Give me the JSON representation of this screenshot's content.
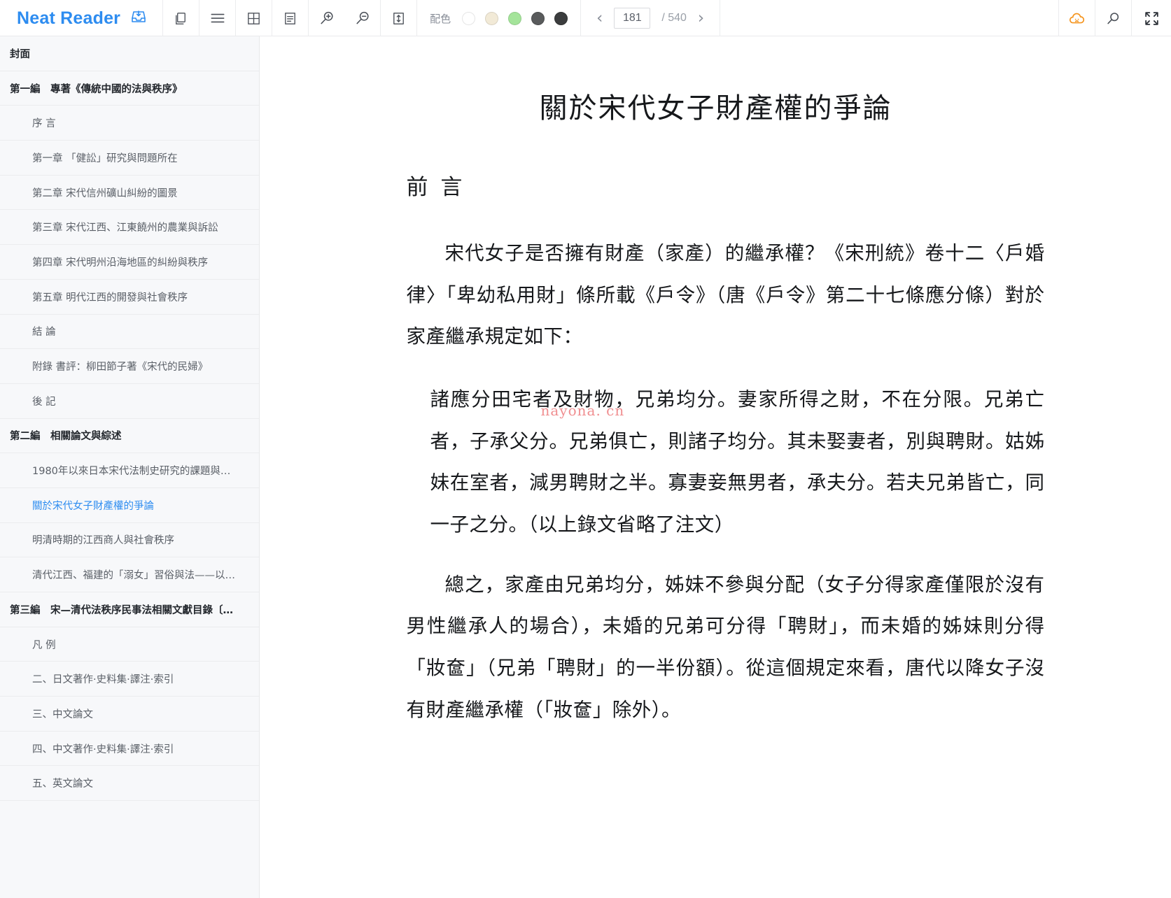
{
  "app": {
    "brand": "Neat Reader"
  },
  "toolbar": {
    "icons": [
      {
        "name": "import-book-icon",
        "label": "Import"
      },
      {
        "name": "bookshelf-icon",
        "label": "Bookshelf"
      },
      {
        "name": "contents-list-icon",
        "label": "Contents"
      },
      {
        "name": "grid-view-icon",
        "label": "Grid view"
      },
      {
        "name": "notes-icon",
        "label": "Notes"
      },
      {
        "name": "zoom-in-icon",
        "label": "Zoom in"
      },
      {
        "name": "zoom-out-icon",
        "label": "Zoom out"
      },
      {
        "name": "line-height-icon",
        "label": "Line height"
      }
    ],
    "palette": {
      "label": "配色",
      "swatches": [
        "#ffffff",
        "#f2ead7",
        "#a4e49a",
        "#595b5c",
        "#3b3d3e"
      ],
      "selected_index": 0
    },
    "pager": {
      "prev_label": "‹",
      "next_label": "›",
      "current_page": "181",
      "total_label": "/ 540"
    },
    "right_icons": [
      {
        "name": "cloud-sync-icon",
        "label": "Cloud sync",
        "color": "#f5941d"
      },
      {
        "name": "search-icon",
        "label": "Search"
      },
      {
        "name": "fullscreen-icon",
        "label": "Fullscreen"
      }
    ]
  },
  "sidebar": {
    "items": [
      {
        "label": "封面",
        "level": 0,
        "active": false
      },
      {
        "label": "第一編　專著《傳統中國的法與秩序》",
        "level": 0,
        "active": false
      },
      {
        "label": "序 言",
        "level": 1,
        "active": false
      },
      {
        "label": "第一章 「健訟」研究與問題所在",
        "level": 1,
        "active": false
      },
      {
        "label": "第二章 宋代信州礦山糾紛的圖景",
        "level": 1,
        "active": false
      },
      {
        "label": "第三章 宋代江西、江東饒州的農業與訴訟",
        "level": 1,
        "active": false
      },
      {
        "label": "第四章 宋代明州沿海地區的糾紛與秩序",
        "level": 1,
        "active": false
      },
      {
        "label": "第五章 明代江西的開發與社會秩序",
        "level": 1,
        "active": false
      },
      {
        "label": "結 論",
        "level": 1,
        "active": false
      },
      {
        "label": "附錄 書評：柳田節子著《宋代的民婦》",
        "level": 1,
        "active": false
      },
      {
        "label": "後 記",
        "level": 1,
        "active": false
      },
      {
        "label": "第二編　相關論文與綜述",
        "level": 0,
        "active": false
      },
      {
        "label": "1980年以來日本宋代法制史研究的課題與…",
        "level": 1,
        "active": false
      },
      {
        "label": "關於宋代女子財產權的爭論",
        "level": 1,
        "active": true
      },
      {
        "label": "明清時期的江西商人與社會秩序",
        "level": 1,
        "active": false
      },
      {
        "label": "清代江西、福建的「溺女」習俗與法——以…",
        "level": 1,
        "active": false
      },
      {
        "label": "第三編　宋—清代法秩序民事法相關文獻目錄〔…",
        "level": 0,
        "active": false
      },
      {
        "label": "凡 例",
        "level": 1,
        "active": false
      },
      {
        "label": "二、日文著作·史料集·譯注·索引",
        "level": 1,
        "active": false
      },
      {
        "label": "三、中文論文",
        "level": 1,
        "active": false
      },
      {
        "label": "四、中文著作·史料集·譯注·索引",
        "level": 1,
        "active": false
      },
      {
        "label": "五、英文論文",
        "level": 1,
        "active": false
      }
    ]
  },
  "content": {
    "title": "關於宋代女子財產權的爭論",
    "section_heading": "前 言",
    "paragraph_1": "宋代女子是否擁有財產（家產）的繼承權？《宋刑統》卷十二〈戶婚律〉「卑幼私用財」條所載《戶令》（唐《戶令》第二十七條應分條）對於家產繼承規定如下：",
    "quote_1": "諸應分田宅者及財物，兄弟均分。妻家所得之財，不在分限。兄弟亡者，子承父分。兄弟俱亡，則諸子均分。其未娶妻者，別與聘財。姑姊妹在室者，減男聘財之半。寡妻妾無男者，承夫分。若夫兄弟皆亡，同一子之分。（以上錄文省略了注文）",
    "paragraph_2": "總之，家產由兄弟均分，姊妹不參與分配（女子分得家產僅限於沒有男性繼承人的場合），未婚的兄弟可分得「聘財」，而未婚的姊妹則分得「妝奩」（兄弟「聘財」的一半份額）。從這個規定來看，唐代以降女子沒有財產繼承權（「妝奩」除外）。",
    "watermark": "nayona. cn"
  }
}
